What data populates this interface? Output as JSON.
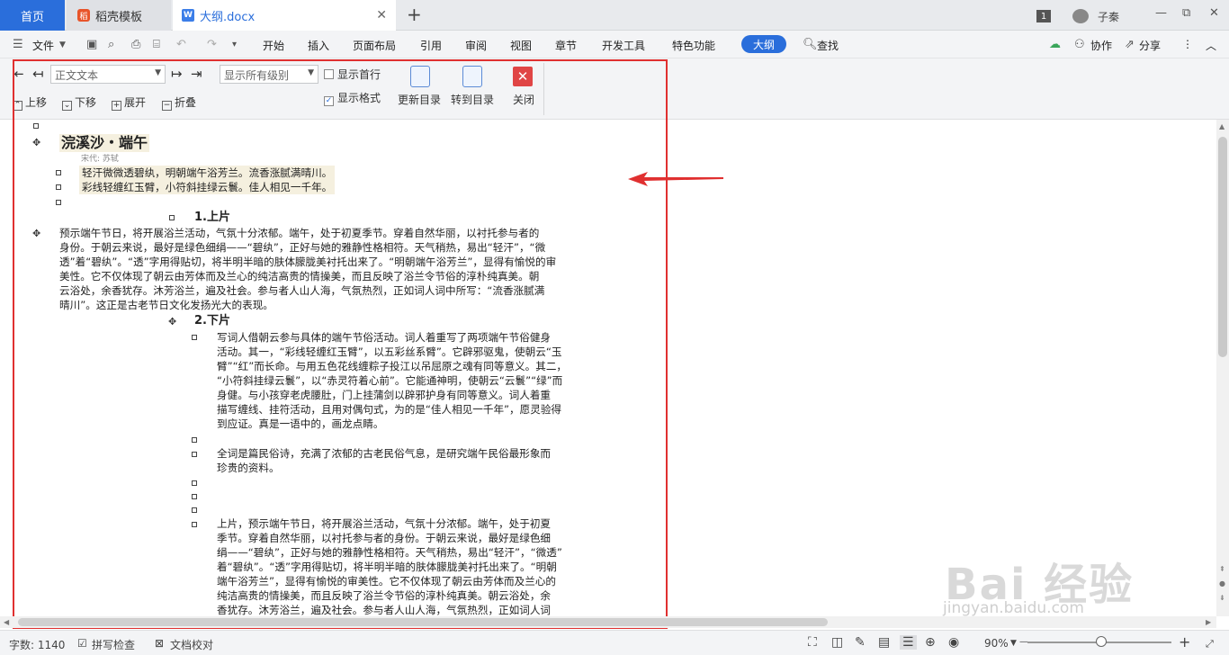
{
  "tabs": {
    "home": "首页",
    "template": "稻壳模板",
    "doc": "大纲.docx",
    "add": "+"
  },
  "window": {
    "badge": "1",
    "user": "子秦",
    "minimize": "—",
    "restore": "⧉",
    "close": "✕"
  },
  "menu": {
    "file": "文件",
    "items": [
      "开始",
      "插入",
      "页面布局",
      "引用",
      "审阅",
      "视图",
      "章节",
      "开发工具",
      "特色功能"
    ],
    "outline": "大纲",
    "find": "查找",
    "collab": "协作",
    "share": "分享",
    "more": "⋮",
    "collapse": "︿"
  },
  "toolbar": {
    "style_select": "正文文本",
    "level_select": "显示所有级别",
    "show_first_line": "显示首行",
    "show_format": "显示格式",
    "update_toc": "更新目录",
    "goto_toc": "转到目录",
    "close": "关闭",
    "move_up": "上移",
    "move_down": "下移",
    "expand": "展开",
    "collapse": "折叠"
  },
  "document": {
    "title": "浣溪沙・端午",
    "author": "宋代: 苏轼",
    "poem_1": "轻汗微微透碧纨，明朝端午浴芳兰。流香涨腻满晴川。",
    "poem_2": "彩线轻缠红玉臂，小符斜挂绿云鬟。佳人相见一千年。",
    "h1": "1.上片",
    "p1": [
      "预示端午节日，将开展浴兰活动，气氛十分浓郁。端午，处于初夏季节。穿着自然华丽，以衬托参与者的",
      "身份。于朝云来说，最好是绿色细绢——“碧纨”，正好与她的雅静性格相符。天气稍热，易出“轻汗”，“微",
      "透”着“碧纨”。“透”字用得贴切，将半明半暗的肤体朦胧美衬托出来了。“明朝端午浴芳兰”，显得有愉悦的审",
      "美性。它不仅体现了朝云由芳体而及兰心的纯洁高贵的情操美，而且反映了浴兰令节俗的淳朴纯真美。朝",
      "云浴处，余香犹存。沐芳浴兰，遍及社会。参与者人山人海，气氛热烈，正如词人词中所写：“流香涨腻满",
      "晴川”。这正是古老节日文化发扬光大的表现。"
    ],
    "h2": "2.下片",
    "p2": [
      "写词人借朝云参与具体的端午节俗活动。词人着重写了两项端午节俗健身",
      "活动。其一，“彩线轻缠红玉臂”，以五彩丝系臂”。它辟邪驱鬼，使朝云“玉",
      "臂”“红”而长命。与用五色花线缠粽子投江以吊屈原之魂有同等意义。其二，",
      "“小符斜挂绿云鬟”，以“赤灵符着心前”。它能通神明，使朝云“云鬟”“绿”而",
      "身健。与小孩穿老虎腰肚，门上挂蒲剑以辟邪护身有同等意义。词人着重",
      "描写缠线、挂符活动，且用对偶句式，为的是“佳人相见一千年”，愿灵验得",
      "到应证。真是一语中的，画龙点睛。"
    ],
    "p3": [
      "全词是篇民俗诗，充满了浓郁的古老民俗气息，是研究端午民俗最形象而",
      "珍贵的资料。"
    ],
    "p4": [
      "上片，预示端午节日，将开展浴兰活动，气氛十分浓郁。端午，处于初夏",
      "季节。穿着自然华丽，以衬托参与者的身份。于朝云来说，最好是绿色细",
      "绢——“碧纨”，正好与她的雅静性格相符。天气稍热，易出“轻汗”，“微透”",
      "着“碧纨”。“透”字用得贴切，将半明半暗的肤体朦胧美衬托出来了。“明朝",
      "端午浴芳兰”，显得有愉悦的审美性。它不仅体现了朝云由芳体而及兰心的",
      "纯洁高贵的情操美，而且反映了浴兰令节俗的淳朴纯真美。朝云浴处，余",
      "香犹存。沐芳浴兰，遍及社会。参与者人山人海，气氛热烈，正如词人词"
    ]
  },
  "status": {
    "word_count": "字数: 1140",
    "spell_check": "拼写检查",
    "doc_proof": "文档校对",
    "zoom": "90%",
    "zoom_minus": "—",
    "zoom_plus": "+"
  },
  "watermark": {
    "main": "Bai 经验",
    "sub": "jingyan.baidu.com"
  },
  "colors": {
    "accent": "#2a6edb",
    "annotation": "#e03030"
  }
}
